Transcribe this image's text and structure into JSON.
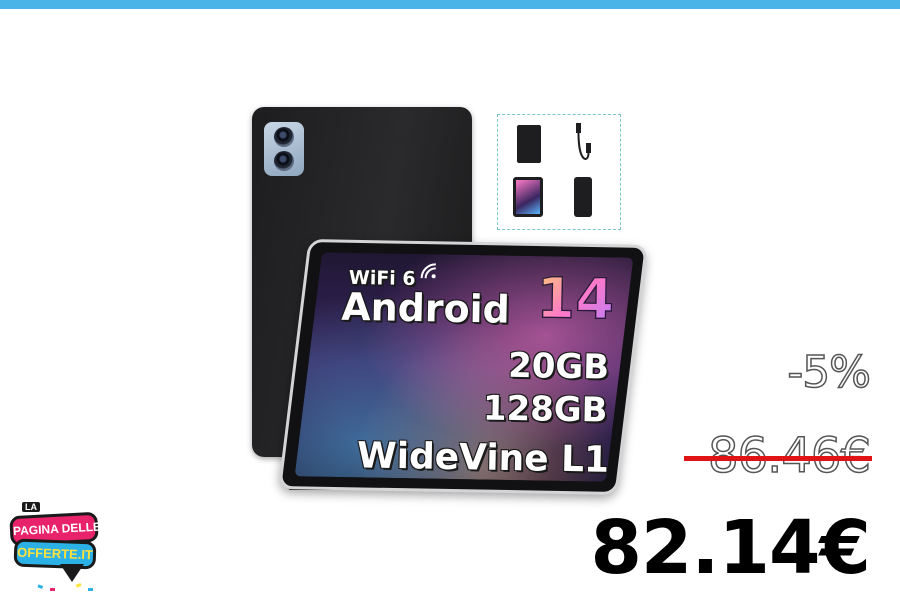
{
  "colors": {
    "top_bar": "#4ab3e8",
    "strike": "#e01414",
    "logo_pink": "#e8236b",
    "logo_blue": "#2bb1e6",
    "logo_yellow": "#ffe23b"
  },
  "product": {
    "screen": {
      "wifi": "WiFi 6",
      "android": "Android",
      "version": "14",
      "ram": "20GB",
      "storage": "128GB",
      "drm": "WideVine L1"
    },
    "accessories_icons": [
      "folio-case-icon",
      "usb-cable-icon",
      "screen-protector-icon",
      "charger-icon"
    ]
  },
  "price": {
    "discount": "-5%",
    "old_price": "86.46€",
    "new_price": "82.14€"
  },
  "logo": {
    "la": "LA",
    "line1": "PAGINA DELLE",
    "line2": "OFFERTE.IT"
  }
}
